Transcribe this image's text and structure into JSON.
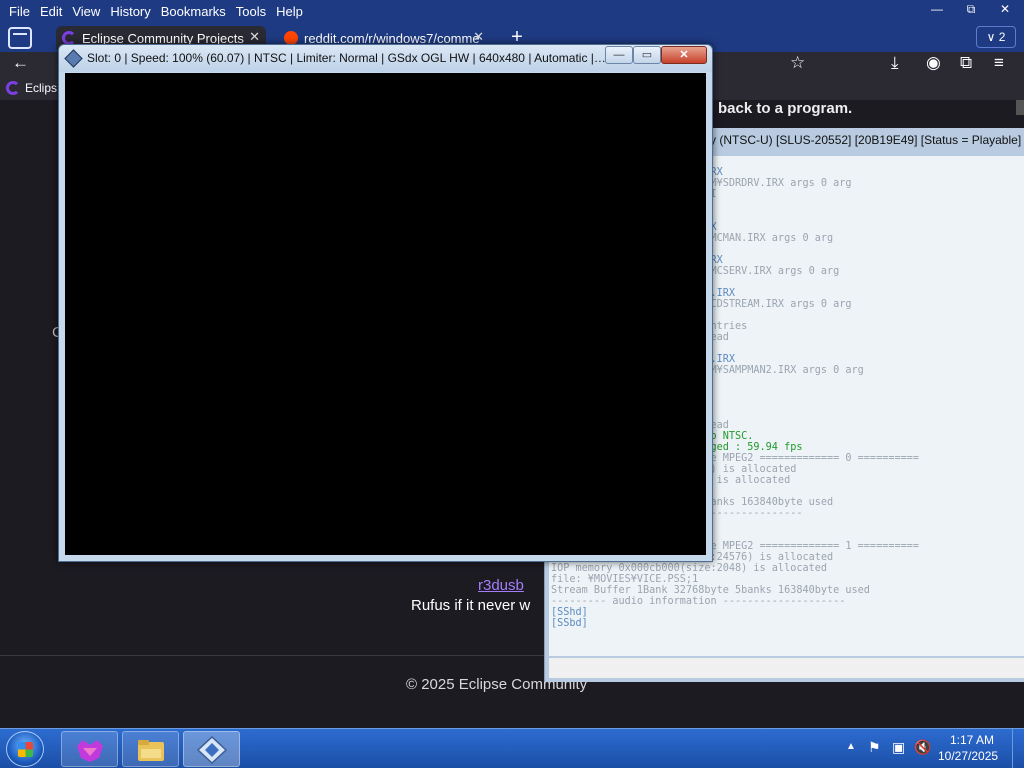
{
  "browser": {
    "menu": [
      "File",
      "Edit",
      "View",
      "History",
      "Bookmarks",
      "Tools",
      "Help"
    ],
    "window_controls": {
      "minimize": "—",
      "restore": "⧉",
      "close": "✕"
    },
    "tabs": [
      {
        "title": "Eclipse Community Projects",
        "close": "✕"
      },
      {
        "title": "reddit.com/r/windows7/comme",
        "close": "✕"
      }
    ],
    "new_tab": "+",
    "tab_count": "2",
    "tab_count_chevron": "∨",
    "nav_icons": {
      "back": "←",
      "bookmark_star": "☆",
      "download": "⤓",
      "account": "◉",
      "extensions": "⧉",
      "menu": "≡"
    },
    "bookmark_item": "Eclips",
    "page": {
      "banner": "back to a program.",
      "left_char": "C",
      "link": "r3dusb",
      "text": "Rufus if it never w",
      "footer": "© 2025 Eclipse Community"
    }
  },
  "pcsx2_main_title": "y (NTSC-U) [SLUS-20552] [20B19E49] [Status = Playable]",
  "console": {
    "lines": [
      {
        "text": "",
        "color": "#5a8bbf"
      },
      {
        "text": "                  SDRDRV.IRX",
        "color": "#5a8bbf"
      },
      {
        "text": "                  0:¥SYSTEM¥SDRDRV.IRX args 0 arg",
        "color": "#9aa5b0"
      },
      {
        "text": "                   (C) SCEI",
        "color": "#9aa5b0"
      },
      {
        "text": "",
        "color": "#9aa5b0"
      },
      {
        "text": "",
        "color": "#9aa5b0"
      },
      {
        "text": "                  MCMAN.IRX",
        "color": "#5a8bbf"
      },
      {
        "text": "                  ¥SYSTEM¥MCMAN.IRX args 0 arg",
        "color": "#9aa5b0"
      },
      {
        "text": "",
        "color": "#9aa5b0"
      },
      {
        "text": "                  MCSERV.IRX",
        "color": "#5a8bbf"
      },
      {
        "text": "                  ¥SYSTEM¥MCSERV.IRX args 0 arg",
        "color": "#9aa5b0"
      },
      {
        "text": "",
        "color": "#9aa5b0"
      },
      {
        "text": "                  CDSTREAM.IRX",
        "color": "#5a8bbf"
      },
      {
        "text": "                  ¥SYSTEM¥CDSTREAM.IRX args 0 arg",
        "color": "#9aa5b0"
      },
      {
        "text": "",
        "color": "#9aa5b0"
      },
      {
        "text": "                  LibraryEntries",
        "color": "#9aa5b0"
      },
      {
        "text": "                  rver Thread",
        "color": "#9aa5b0"
      },
      {
        "text": "",
        "color": "#9aa5b0"
      },
      {
        "text": "                  SAMPMAN2.IRX",
        "color": "#5a8bbf"
      },
      {
        "text": "                  0:¥SYSTEM¥SAMPMAN2.IRX args 0 arg",
        "color": "#9aa5b0"
      },
      {
        "text": "",
        "color": "#9aa5b0"
      },
      {
        "text": "                  00",
        "color": "#9aa5b0"
      },
      {
        "text": "                  ue c5900",
        "color": "#9aa5b0"
      },
      {
        "text": "                  5a00",
        "color": "#9aa5b0"
      },
      {
        "text": "                  ming Thread",
        "color": "#9aa5b0"
      },
      {
        "text": "                  hanged to NTSC.",
        "color": "#1f9b2a"
      },
      {
        "text": "                  mit Changed : 59.94 fps",
        "color": "#1f9b2a"
      },
      {
        "text": "                  == decode MPEG2 ============= 0 ==========",
        "color": "#9aa5b0"
      },
      {
        "text": "                  ze:24576) is allocated",
        "color": "#9aa5b0"
      },
      {
        "text": "                  ze:2048) is allocated",
        "color": "#9aa5b0"
      },
      {
        "text": "                  S;1",
        "color": "#9aa5b0"
      },
      {
        "text": "                  8byte 5banks 163840byte used",
        "color": "#9aa5b0"
      },
      {
        "text": "                  on --------------------",
        "color": "#9aa5b0"
      },
      {
        "text": "",
        "color": "#9aa5b0"
      },
      {
        "text": "",
        "color": "#9aa5b0"
      },
      {
        "text": "                  == decode MPEG2 ============= 1 ==========",
        "color": "#9aa5b0"
      },
      {
        "text": "IOP memory 0x000cb800(size:24576) is allocated",
        "color": "#9aa5b0"
      },
      {
        "text": "IOP memory 0x000cb000(size:2048) is allocated",
        "color": "#9aa5b0"
      },
      {
        "text": "file: ¥MOVIES¥VICE.PSS;1",
        "color": "#9aa5b0"
      },
      {
        "text": "Stream Buffer 1Bank 32768byte 5banks 163840byte used",
        "color": "#9aa5b0"
      },
      {
        "text": "--------- audio information --------------------",
        "color": "#9aa5b0"
      },
      {
        "text": "[SShd]",
        "color": "#5a8bbf"
      },
      {
        "text": "[SSbd]",
        "color": "#5a8bbf"
      }
    ]
  },
  "gs_window": {
    "title": "Slot: 0 | Speed: 100% (60.07) | NTSC | Limiter: Normal | GSdx OGL HW | 640x480 | Automatic | In...",
    "buttons": {
      "minimize": "—",
      "maximize": "▭",
      "close": "✕"
    }
  },
  "taskbar": {
    "time": "1:17 AM",
    "date": "10/27/2025",
    "tray": {
      "arrow": "▲",
      "flag": "⚑",
      "network": "▣",
      "volume": "🔇"
    }
  },
  "colors": {
    "titlebar_blue": "#1e3a82",
    "page_bg": "#1c1b22",
    "link": "#a57dfa",
    "console_bg": "#eef3f7",
    "console_green": "#1f9b2a",
    "console_blue": "#5a8bbf",
    "taskbar": "#2d6cd0"
  }
}
